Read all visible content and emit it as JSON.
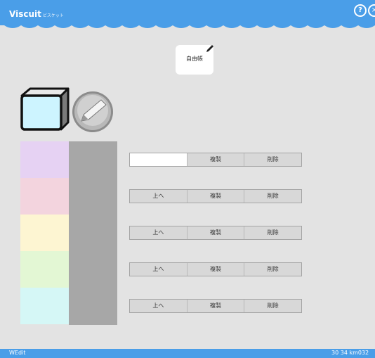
{
  "header": {
    "app_name": "Viscuit",
    "app_subtitle": "ビスケット",
    "help_icon": "?",
    "close_icon": "×"
  },
  "notebook": {
    "label": "自由帳",
    "icon": "pencil-icon"
  },
  "tools": {
    "box_icon": "box-icon",
    "pen_icon": "pen-icon"
  },
  "swatches": [
    "#e6d2f3",
    "#f3d4de",
    "#fdf5d2",
    "#e3f7d4",
    "#d5f7f6"
  ],
  "rows": [
    {
      "first": "",
      "copy": "複製",
      "delete": "削除"
    },
    {
      "first": "上へ",
      "copy": "複製",
      "delete": "削除"
    },
    {
      "first": "上へ",
      "copy": "複製",
      "delete": "削除"
    },
    {
      "first": "上へ",
      "copy": "複製",
      "delete": "削除"
    },
    {
      "first": "上へ",
      "copy": "複製",
      "delete": "削除"
    }
  ],
  "footer": {
    "left": "WEdit",
    "right": "30 34 km032"
  },
  "colors": {
    "accent": "#4a9ee8",
    "background": "#e3e3e3",
    "gray_column": "#a7a7a7"
  }
}
